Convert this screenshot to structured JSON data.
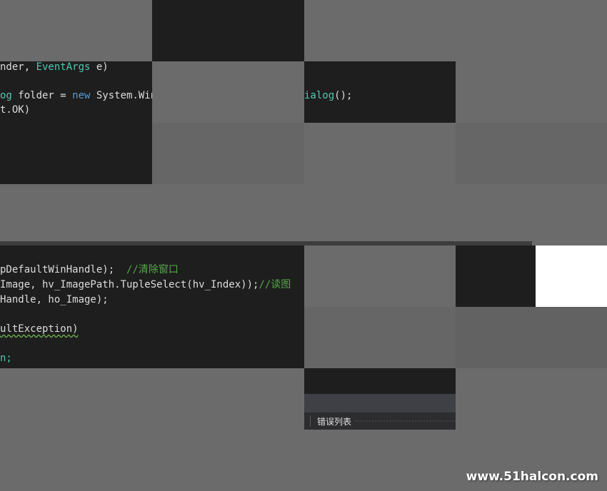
{
  "code": {
    "line1": {
      "pre": "nder, ",
      "type": "EventArgs",
      "post": " e)"
    },
    "line2": {
      "pre_type": "og",
      "mid": " folder = ",
      "kw": "new",
      "mid2": " System.Win",
      "tail_type": "ialog",
      "tail": "();"
    },
    "line3": "t.OK)",
    "line4": {
      "pre": "pDefaultWinHandle);  ",
      "comment": "//清除窗口"
    },
    "line5": {
      "pre": "Image, hv_ImagePath.TupleSelect(hv_Index));",
      "comment": "//读图"
    },
    "line6": "Handle, ho_Image);",
    "line7": "ultException)",
    "line8": "n;"
  },
  "panel": {
    "error_list_tab": "错误列表"
  },
  "watermark": "www.51halcon.com"
}
